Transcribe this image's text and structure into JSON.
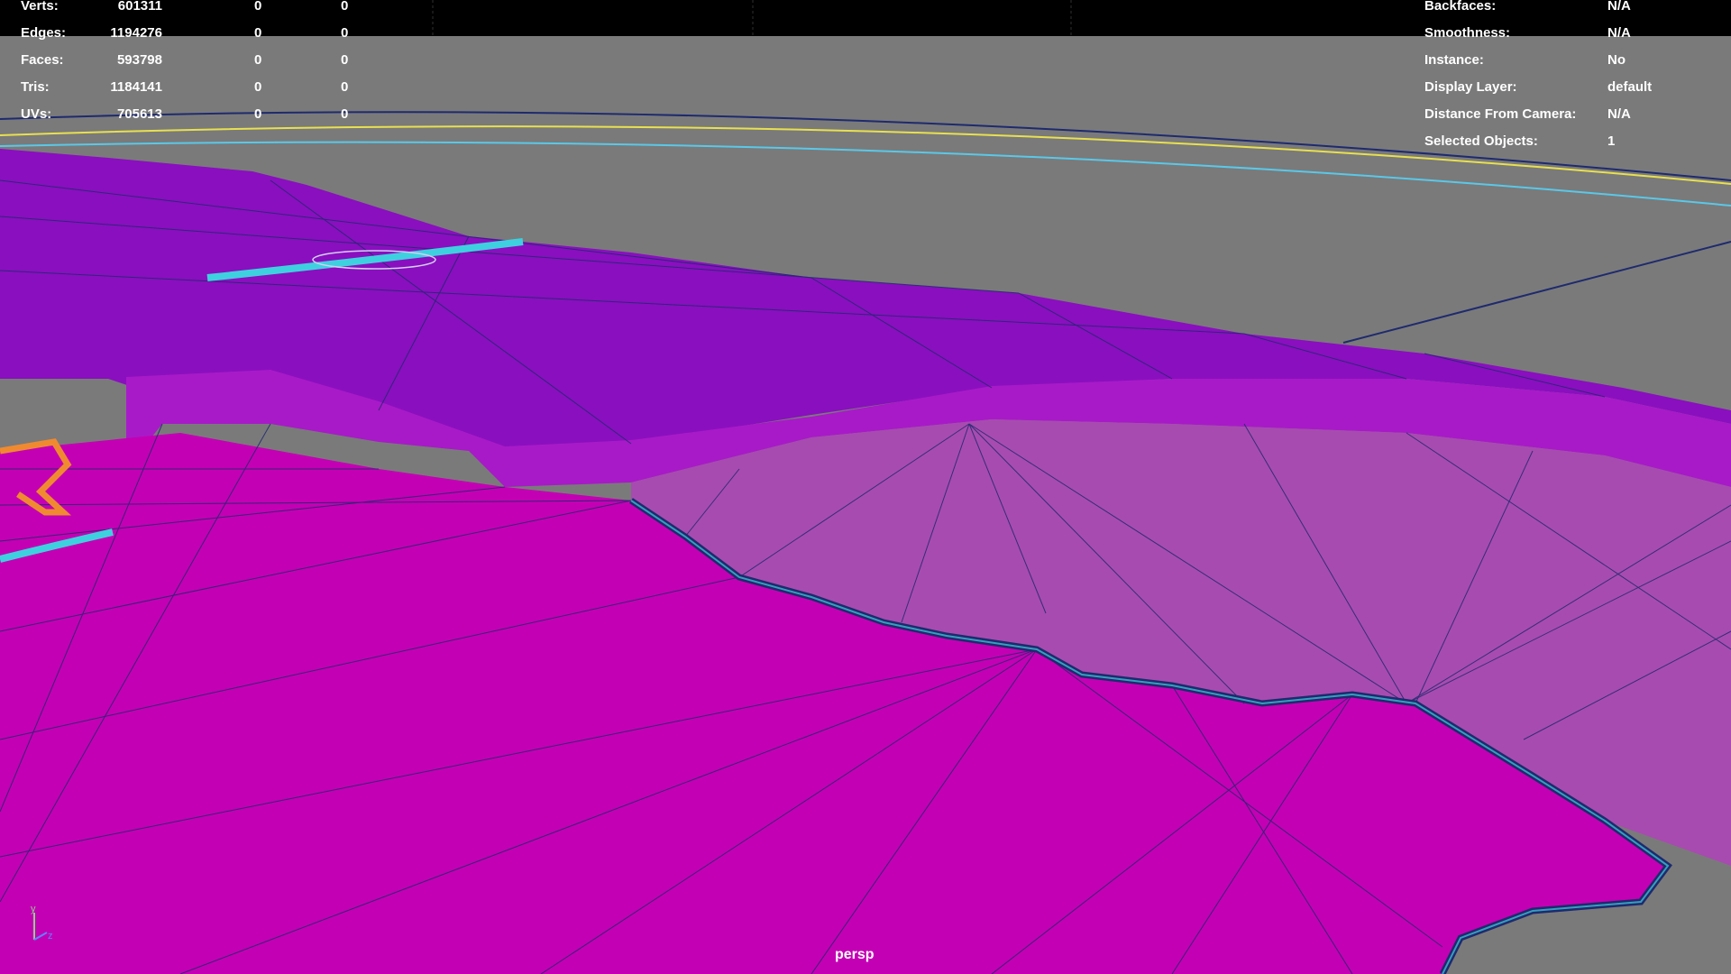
{
  "app": "Maya viewport",
  "heads_up_display": {
    "poly_count": [
      {
        "label": "Verts:",
        "values": [
          "601311",
          "0",
          "0"
        ]
      },
      {
        "label": "Edges:",
        "values": [
          "1194276",
          "0",
          "0"
        ]
      },
      {
        "label": "Faces:",
        "values": [
          "593798",
          "0",
          "0"
        ]
      },
      {
        "label": "Tris:",
        "values": [
          "1184141",
          "0",
          "0"
        ]
      },
      {
        "label": "UVs:",
        "values": [
          "705613",
          "0",
          "0"
        ]
      }
    ],
    "object_details": [
      {
        "label": "Backfaces:",
        "value": "N/A"
      },
      {
        "label": "Smoothness:",
        "value": "N/A"
      },
      {
        "label": "Instance:",
        "value": "No"
      },
      {
        "label": "Display Layer:",
        "value": "default"
      },
      {
        "label": "Distance From Camera:",
        "value": "N/A"
      },
      {
        "label": "Selected Objects:",
        "value": "1"
      }
    ]
  },
  "camera": {
    "name": "persp"
  },
  "axis_gizmo": {
    "y_label": "y",
    "z_label": "z"
  },
  "colors": {
    "viewport_bg": "#7a7a7a",
    "top_bar": "#000000",
    "mesh_dark": "#8a0fbf",
    "mesh_mid": "#a81ac8",
    "mesh_bright": "#c400b4",
    "mesh_lilac": "#a84bb0",
    "wireframe": "#1e2a6e",
    "highlight_cyan": "#3fd0e0",
    "highlight_orange": "#f08a30",
    "horizon_yellow": "#e8e050",
    "horizon_cyan": "#5ac8e8"
  }
}
